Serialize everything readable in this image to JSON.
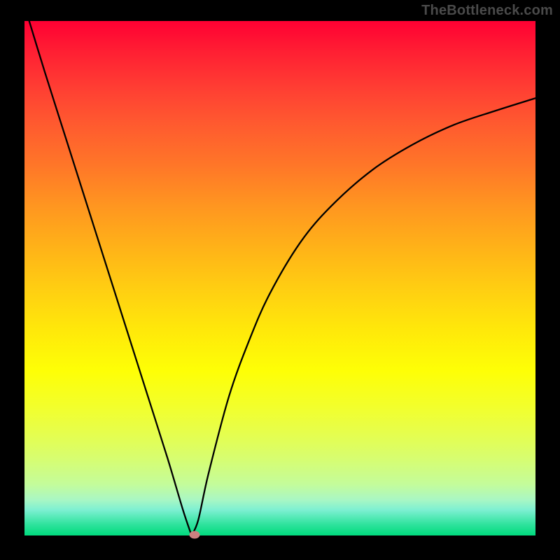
{
  "watermark": "TheBottleneck.com",
  "chart_data": {
    "type": "line",
    "title": "",
    "xlabel": "",
    "ylabel": "",
    "xlim": [
      0,
      100
    ],
    "ylim": [
      0,
      100
    ],
    "background_gradient_stops": [
      {
        "pos": 0,
        "color": "#ff0033"
      },
      {
        "pos": 50,
        "color": "#ffd000"
      },
      {
        "pos": 75,
        "color": "#feff06"
      },
      {
        "pos": 100,
        "color": "#00db7e"
      }
    ],
    "series": [
      {
        "name": "bottleneck-curve",
        "x": [
          0,
          4,
          8,
          12,
          16,
          20,
          24,
          28,
          31,
          32.7,
          34,
          36,
          40,
          44,
          48,
          54,
          60,
          68,
          76,
          84,
          92,
          100
        ],
        "y": [
          103,
          90,
          77.5,
          65,
          52.5,
          40,
          27.5,
          15,
          5,
          0,
          3,
          12,
          27,
          38,
          47,
          57,
          64,
          71,
          76,
          79.8,
          82.5,
          85
        ]
      }
    ],
    "marker": {
      "x": 33.3,
      "y": 0.2,
      "color": "#cc8080"
    },
    "description": "V-shaped curve on a vertical rainbow gradient (red top to green bottom). Minimum near x≈33 where curve touches y=0; left branch descends linearly from top-left, right branch rises with decreasing slope toward top-right."
  }
}
